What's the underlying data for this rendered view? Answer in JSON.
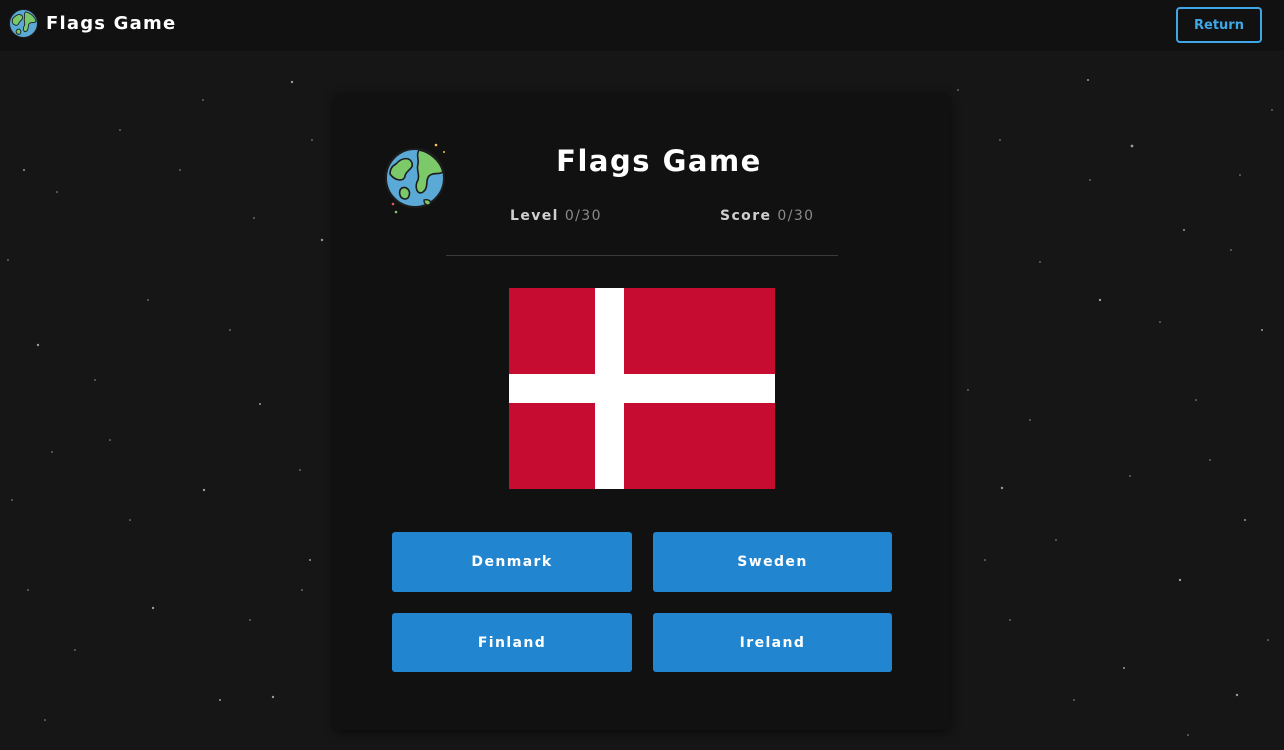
{
  "navbar": {
    "title": "Flags Game",
    "logo_icon": "globe-icon",
    "return_label": "Return"
  },
  "game": {
    "title": "Flags Game",
    "logo_icon": "globe-icon",
    "level_label": "Level",
    "level_value": "0/30",
    "score_label": "Score",
    "score_value": "0/30",
    "flag": {
      "country": "Denmark",
      "colors": {
        "red": "#c60c30",
        "cross": "#ffffff"
      }
    },
    "answers": [
      "Denmark",
      "Sweden",
      "Finland",
      "Ireland"
    ]
  },
  "colors": {
    "background": "#161616",
    "navbar": "#111111",
    "card": "#111111",
    "accent": "#3fa7e6",
    "answer_button": "#2185d0"
  }
}
